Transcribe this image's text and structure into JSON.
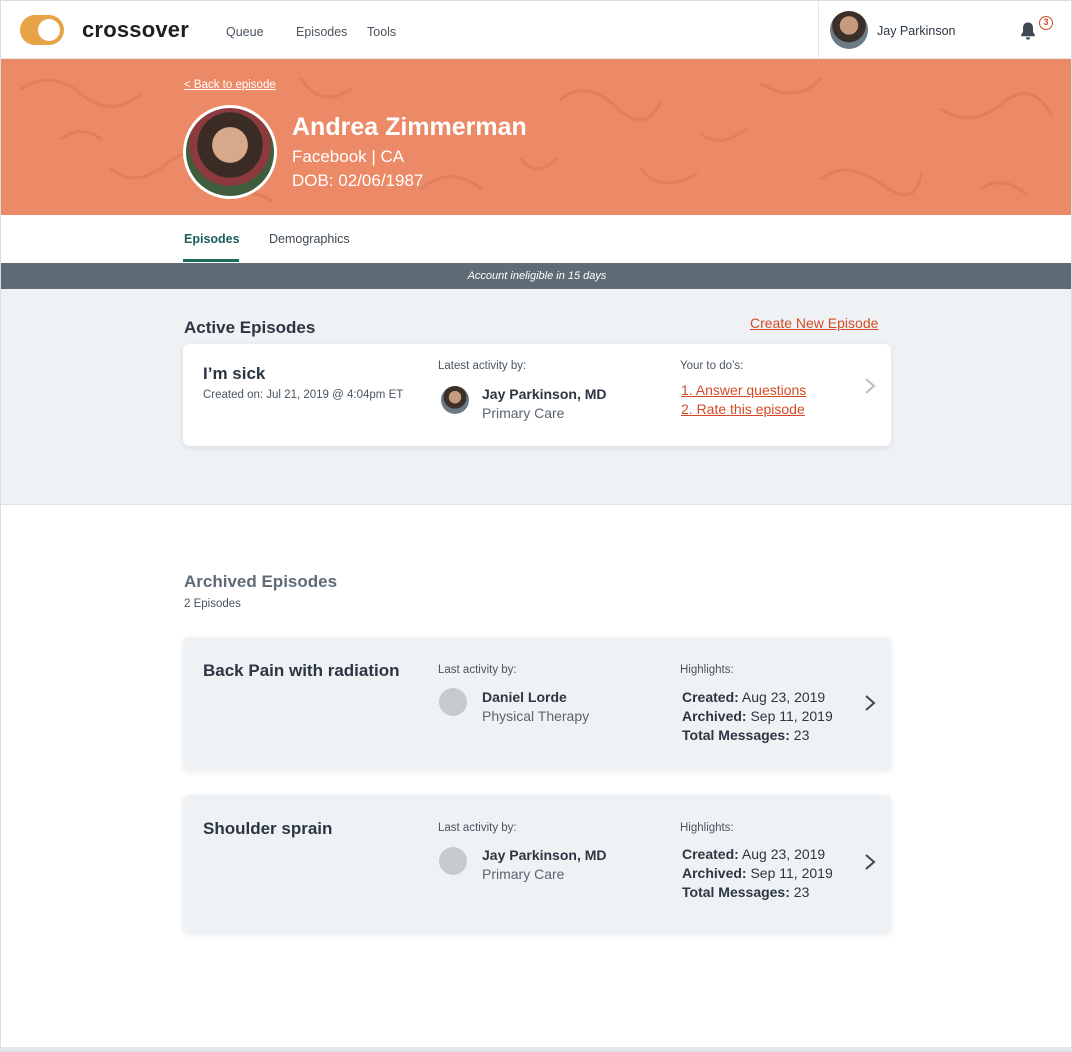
{
  "app": {
    "logo": "crossover",
    "nav": [
      "Queue",
      "Episodes",
      "Tools"
    ],
    "user_name": "Jay Parkinson",
    "notification_count": "3"
  },
  "patient": {
    "back_link": "< Back to episode",
    "name": "Andrea Zimmerman",
    "org": "Facebook | CA",
    "dob": "DOB: 02/06/1987"
  },
  "tabs": [
    "Episodes",
    "Demographics"
  ],
  "banner": "Account ineligible in 15 days",
  "active": {
    "title": "Active Episodes",
    "create_link": "Create New Episode",
    "episode": {
      "title": "I’m sick",
      "created": "Created on: Jul 21, 2019 @ 4:04pm ET",
      "activity_label": "Latest activity by:",
      "activity_name": "Jay Parkinson, MD",
      "activity_role": "Primary Care",
      "todo_label": "Your to do’s:",
      "todos": [
        "1. Answer questions",
        "2. Rate this episode"
      ]
    }
  },
  "archived": {
    "title": "Archived Episodes",
    "count": "2 Episodes",
    "episodes": [
      {
        "title": "Back Pain with radiation",
        "activity_label": "Last activity by:",
        "activity_name": "Daniel Lorde",
        "activity_role": "Physical Therapy",
        "highlights_label": "Highlights:",
        "created_label": "Created:",
        "created_value": " Aug 23, 2019",
        "archived_label": "Archived:",
        "archived_value": " Sep 11, 2019",
        "messages_label": "Total Messages:",
        "messages_value": " 23"
      },
      {
        "title": "Shoulder sprain",
        "activity_label": "Last activity by:",
        "activity_name": "Jay Parkinson, MD",
        "activity_role": "Primary Care",
        "highlights_label": "Highlights:",
        "created_label": "Created:",
        "created_value": " Aug 23, 2019",
        "archived_label": "Archived:",
        "archived_value": " Sep 11, 2019",
        "messages_label": "Total Messages:",
        "messages_value": " 23"
      }
    ]
  },
  "colors": {
    "accent": "#d34b25",
    "hero": "#ec8966",
    "brand_toggle": "#e6a446",
    "tab_active": "#1c6b5e",
    "banner": "#5f6b75"
  }
}
